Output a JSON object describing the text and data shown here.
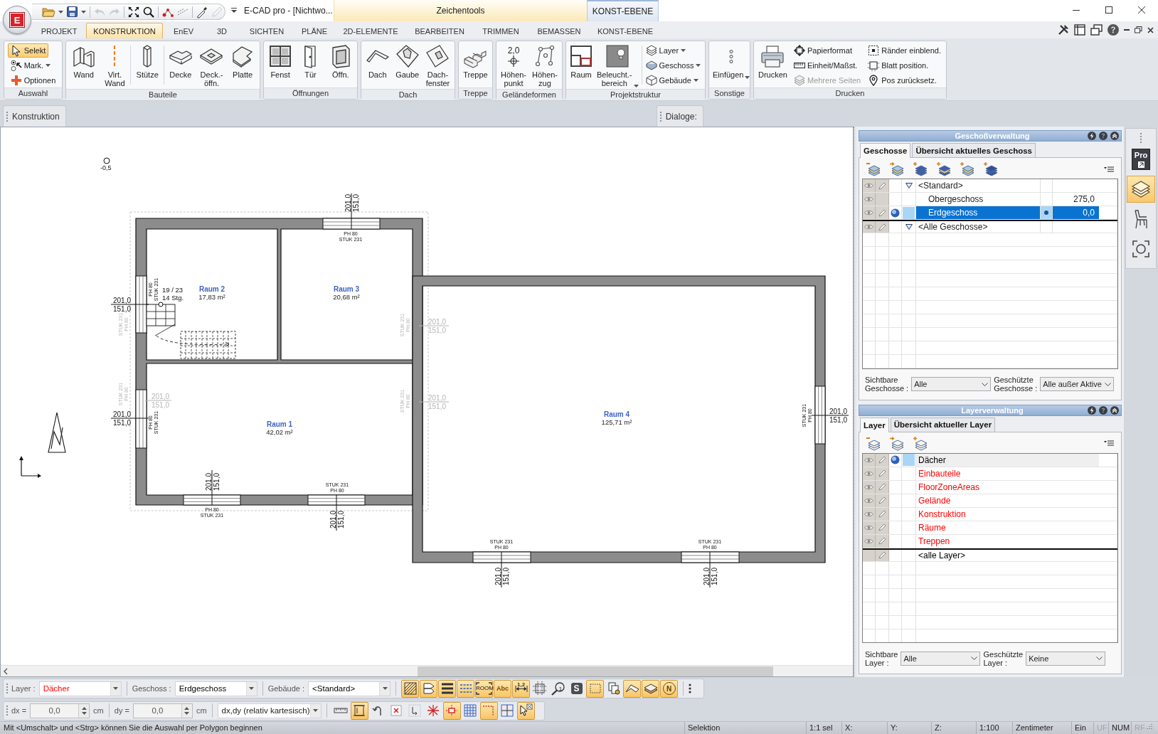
{
  "app": {
    "logo": "E",
    "title": "E-CAD pro - [Nichtwo...",
    "context_tabs": [
      {
        "kind": "tools",
        "label": "Zeichentools"
      },
      {
        "kind": "layer",
        "label": "KONST-EBENE"
      }
    ]
  },
  "ribbon_tabs": [
    {
      "label": "PROJEKT",
      "selected": false
    },
    {
      "label": "KONSTRUKTION",
      "selected": true
    },
    {
      "label": "EnEV",
      "selected": false
    },
    {
      "label": "3D",
      "selected": false
    },
    {
      "label": "SICHTEN",
      "selected": false
    },
    {
      "label": "PLÄNE",
      "selected": false
    },
    {
      "label": "2D-ELEMENTE",
      "selected": false
    },
    {
      "label": "BEARBEITEN",
      "selected": false
    },
    {
      "label": "TRIMMEN",
      "selected": false
    },
    {
      "label": "BEMASSEN",
      "selected": false
    },
    {
      "label": "KONST-EBENE",
      "selected": false
    }
  ],
  "ribbon_groups": [
    {
      "caption": "Auswahl",
      "sections": [
        [
          {
            "kind": "stack",
            "items": [
              {
                "label": "Selekt",
                "on": true
              },
              {
                "label": "Mark.",
                "on": false,
                "dropdown": true
              },
              {
                "label": "Optionen",
                "on": false
              }
            ]
          }
        ]
      ]
    },
    {
      "caption": "Bauteile",
      "sections": [
        [
          {
            "kind": "large",
            "label": "Wand"
          },
          {
            "kind": "large",
            "label": "Virt.\nWand"
          }
        ],
        [
          {
            "kind": "large",
            "label": "Stütze"
          }
        ],
        [
          {
            "kind": "large",
            "label": "Decke"
          },
          {
            "kind": "large",
            "label": "Deck.-\nöffn."
          },
          {
            "kind": "large",
            "label": "Platte"
          }
        ]
      ]
    },
    {
      "caption": "Öffnungen",
      "sections": [
        [
          {
            "kind": "large",
            "label": "Fenst"
          },
          {
            "kind": "large",
            "label": "Tür"
          },
          {
            "kind": "large",
            "label": "Öffn."
          }
        ]
      ]
    },
    {
      "caption": "Dach",
      "sections": [
        [
          {
            "kind": "large",
            "label": "Dach"
          },
          {
            "kind": "large",
            "label": "Gaube"
          },
          {
            "kind": "large",
            "label": "Dach-\nfenster"
          }
        ]
      ]
    },
    {
      "caption": "Treppe",
      "sections": [
        [
          {
            "kind": "large",
            "label": "Treppe"
          }
        ]
      ]
    },
    {
      "caption": "Geländeformen",
      "sections": [
        [
          {
            "kind": "large",
            "label": "Höhen-\npunkt",
            "icon_text": "2,0"
          },
          {
            "kind": "large",
            "label": "Höhen-\nzug"
          }
        ]
      ]
    },
    {
      "caption": "Projektstruktur",
      "sections": [
        [
          {
            "kind": "large",
            "label": "Raum"
          },
          {
            "kind": "large",
            "label": "Beleucht.-\nbereich",
            "dropdown": true
          }
        ],
        [
          {
            "kind": "stack",
            "items": [
              {
                "label": "Layer",
                "dropdown": true
              },
              {
                "label": "Geschoss",
                "dropdown": true
              },
              {
                "label": "Gebäude",
                "dropdown": true
              }
            ]
          }
        ]
      ]
    },
    {
      "caption": "Sonstige",
      "sections": [
        [
          {
            "kind": "large",
            "label": "Einfügen",
            "dropdown": true
          }
        ]
      ]
    },
    {
      "caption": "Drucken",
      "sections": [
        [
          {
            "kind": "large",
            "label": "Drucken"
          },
          {
            "kind": "stack",
            "items": [
              {
                "label": "Papierformat",
                "disabled": false
              },
              {
                "label": "Einheit/Maßst.",
                "disabled": false
              },
              {
                "label": "Mehrere Seiten",
                "disabled": true
              }
            ]
          },
          {
            "kind": "stack",
            "items": [
              {
                "label": "Ränder einblend."
              },
              {
                "label": "Blatt position."
              },
              {
                "label": "Pos zurücksetz."
              }
            ]
          }
        ]
      ]
    }
  ],
  "subbar": {
    "title": "Konstruktion",
    "dialogs": "Dialoge:"
  },
  "drawing": {
    "level": "-0,5",
    "rooms": [
      {
        "name": "Raum 2",
        "area": "17,83 m²"
      },
      {
        "name": "Raum 3",
        "area": "20,68 m²"
      },
      {
        "name": "Raum 1",
        "area": "42,02 m²"
      },
      {
        "name": "Raum 4",
        "area": "125,71 m²"
      }
    ],
    "stair": {
      "ratio": "19 / 23",
      "steps": "14 Stg."
    },
    "marks": [
      {
        "faded": false,
        "dims": [
          "201,0",
          "151,0"
        ],
        "tags": [
          "PH 80",
          "STUK 231"
        ]
      },
      {
        "faded": false,
        "dims": [
          "201,0",
          "151,0"
        ],
        "tags": [
          "PH 80",
          "STUK 231"
        ]
      },
      {
        "faded": true,
        "tags": [
          "STUK 231",
          "PH 80"
        ]
      },
      {
        "faded": false,
        "dims": [
          "201,0",
          "151,0"
        ],
        "tags": [
          "PH 80",
          "STUK 231"
        ]
      },
      {
        "faded": true,
        "dims": [
          "201,0",
          "151,0"
        ],
        "tags": [
          "STUK 231",
          "PH 80"
        ]
      },
      {
        "faded": false,
        "dims": [
          "201,0",
          "151,0"
        ],
        "tags": [
          "PH 80",
          "STUK 231"
        ]
      },
      {
        "faded": false,
        "dims": [
          "201,0",
          "151,0"
        ],
        "tags": [
          "STUK 231",
          "PH 80"
        ]
      },
      {
        "faded": true,
        "dims": [
          "201,0",
          "151,0"
        ],
        "tags": [
          "STUK 231",
          "PH 80"
        ]
      },
      {
        "faded": true,
        "dims": [
          "201,0",
          "151,0"
        ],
        "tags": [
          "STUK 231",
          "PH 80"
        ]
      },
      {
        "faded": false,
        "dims": [
          "201,0",
          "151,0"
        ],
        "tags": [
          "STUK 231",
          "PH 80"
        ]
      },
      {
        "faded": false,
        "dims": [
          "201,0",
          "151,0"
        ],
        "tags": [
          "STUK 231",
          "PH 80"
        ]
      },
      {
        "faded": false,
        "dims": [
          "201,0",
          "151,0"
        ],
        "tags": [
          "STUK 231",
          "PH 80"
        ]
      }
    ]
  },
  "storey_panel": {
    "title": "Geschoßverwaltung",
    "tabs": [
      {
        "label": "Geschosse",
        "selected": true
      },
      {
        "label": "Übersicht aktuelles Geschoss",
        "selected": false
      }
    ],
    "rows": [
      {
        "kind": "group",
        "label": "<Standard>",
        "expanded": true,
        "visible": true,
        "editable": true,
        "selected": false,
        "children": [
          {
            "label": "Obergeschoss",
            "value": "275,0",
            "visible": true,
            "editable": false,
            "active": false,
            "selected": false
          },
          {
            "label": "Erdgeschoss",
            "value": "0,0",
            "visible": true,
            "editable": true,
            "active": true,
            "selected": true
          }
        ]
      },
      {
        "kind": "all",
        "label": "<Alle Geschosse>",
        "expanded": true,
        "visible": true,
        "editable": true,
        "selected": false
      }
    ],
    "filters": [
      {
        "label": "Sichtbare\nGeschosse :",
        "value": "Alle"
      },
      {
        "label": "Geschützte\nGeschosse :",
        "value": "Alle außer Aktive"
      }
    ]
  },
  "layer_panel": {
    "title": "Layerverwaltung",
    "tabs": [
      {
        "label": "Layer",
        "selected": true
      },
      {
        "label": "Übersicht aktueller Layer",
        "selected": false
      }
    ],
    "rows": [
      {
        "kind": "layer",
        "label": "Dächer",
        "color": "#000000",
        "visible": true,
        "editable": true,
        "active": true
      },
      {
        "kind": "layer",
        "label": "Einbauteile",
        "color": "#ff0000",
        "visible": true,
        "editable": true,
        "active": false
      },
      {
        "kind": "layer",
        "label": "FloorZoneAreas",
        "color": "#ff0000",
        "visible": true,
        "editable": true,
        "active": false
      },
      {
        "kind": "layer",
        "label": "Gelände",
        "color": "#ff0000",
        "visible": true,
        "editable": true,
        "active": false
      },
      {
        "kind": "layer",
        "label": "Konstruktion",
        "color": "#ff0000",
        "visible": true,
        "editable": true,
        "active": false
      },
      {
        "kind": "layer",
        "label": "Räume",
        "color": "#ff0000",
        "visible": true,
        "editable": true,
        "active": false
      },
      {
        "kind": "layer",
        "label": "Treppen",
        "color": "#ff0000",
        "visible": true,
        "editable": true,
        "active": false
      },
      {
        "kind": "all",
        "label": "<alle Layer>",
        "color": "#000000",
        "visible": false,
        "editable": true,
        "active": false
      }
    ],
    "filters": [
      {
        "label": "Sichtbare\nLayer :",
        "value": "Alle"
      },
      {
        "label": "Geschützte\nLayer :",
        "value": "Keine"
      }
    ]
  },
  "sidebar": [
    {
      "kind": "pro",
      "label": "Pro",
      "selected": false
    },
    {
      "kind": "layers",
      "selected": true
    },
    {
      "kind": "furniture",
      "selected": false
    },
    {
      "kind": "focus",
      "selected": false
    }
  ],
  "layer_bar": {
    "fields": [
      {
        "label": "Layer :",
        "value": "Dächer",
        "color": "#ff0000"
      },
      {
        "label": "Geschoss :",
        "value": "Erdgeschoss",
        "color": "#000000"
      },
      {
        "label": "Gebäude :",
        "value": "<Standard>",
        "color": "#000000"
      }
    ],
    "tools": [
      {
        "on": true
      },
      {
        "on": true
      },
      {
        "on": true
      },
      {
        "on": true
      },
      {
        "on": true,
        "text": "ROOM"
      },
      {
        "on": true,
        "text": "Abc"
      },
      {
        "on": true,
        "text": "1,2"
      },
      {
        "on": false
      },
      {
        "on": false,
        "text": "1"
      },
      {
        "on": false,
        "text": "S"
      },
      {
        "on": true
      },
      {
        "on": false
      },
      {
        "on": true
      },
      {
        "on": true
      },
      {
        "on": true,
        "text": "N"
      }
    ]
  },
  "offset_bar": {
    "fields": [
      {
        "label": "dx =",
        "value": "0,0",
        "unit": "cm"
      },
      {
        "label": "dy =",
        "value": "0,0",
        "unit": "cm"
      }
    ],
    "mode": "dx,dy (relativ kartesisch)",
    "tools": [
      {
        "on": false
      },
      {
        "on": true
      },
      {
        "on": false
      },
      {
        "on": false
      },
      {
        "on": false
      },
      {
        "on": false
      },
      {
        "on": true
      },
      {
        "on": false
      },
      {
        "on": true
      },
      {
        "on": false
      },
      {
        "on": true
      }
    ]
  },
  "status_bar": {
    "message": "Mit <Umschalt> und <Strg> können Sie die Auswahl per Polygon beginnen",
    "panes": [
      {
        "text": "Selektion",
        "disabled": false
      },
      {
        "text": "1:1 sel",
        "disabled": false
      },
      {
        "text": "X:",
        "disabled": false
      },
      {
        "text": "Y:",
        "disabled": false
      },
      {
        "text": "Z:",
        "disabled": false
      },
      {
        "text": "1:100",
        "disabled": false
      },
      {
        "text": "Zentimeter",
        "disabled": false
      },
      {
        "text": "Ein",
        "disabled": false
      },
      {
        "text": "UF",
        "disabled": true
      },
      {
        "text": "NUM",
        "disabled": false
      },
      {
        "text": "RF",
        "disabled": true
      }
    ]
  }
}
